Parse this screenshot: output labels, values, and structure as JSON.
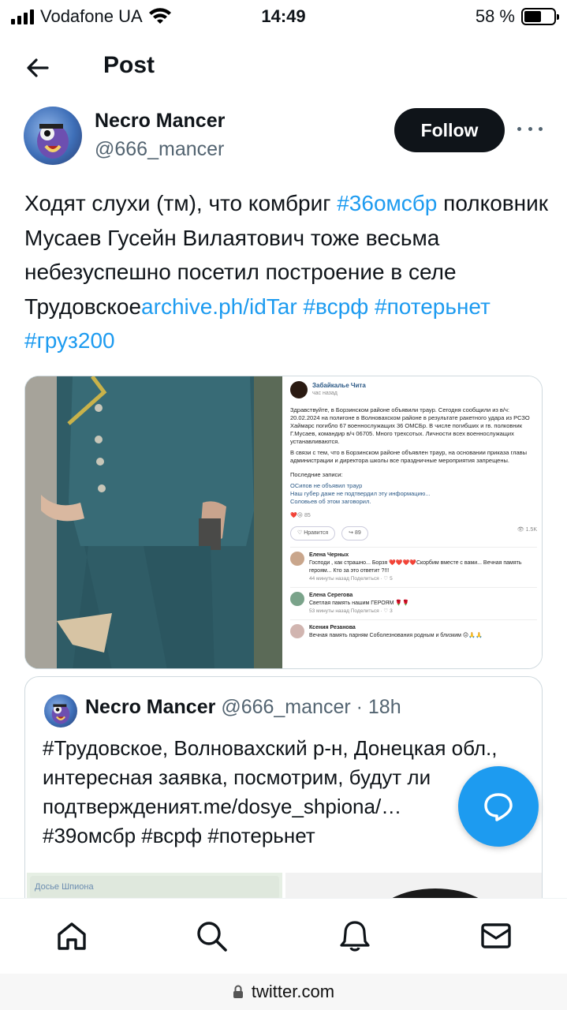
{
  "status_bar": {
    "carrier": "Vodafone UA",
    "time": "14:49",
    "battery_percent": "58 %",
    "battery_level": 0.58
  },
  "header": {
    "title": "Post"
  },
  "author": {
    "name": "Necro Mancer",
    "handle": "@666_mancer",
    "follow_label": "Follow"
  },
  "tweet": {
    "text_plain": "Ходят слухи (тм), что комбриг ",
    "hashtag_1": "#36омсбр",
    "text_plain_2": " полковник Мусаев Гусейн Вилаятович тоже весьма небезуспешно посетил построение в селе Трудовское",
    "link": "archive.ph/idTar",
    "hashtag_2": "#всрф",
    "hashtag_3": "#потерьнет",
    "hashtag_4": "#груз200"
  },
  "media_screenshot": {
    "channel": "Забайкалье Чита",
    "subtitle": "час назад",
    "paragraph_1": "Здравствуйте, в Борзинском районе объявили траур. Сегодня сообщили из в/ч: 20.02.2024 на полигоне в Волновахском районе в результате ракетного удара из РСЗО Хаймарс погибло 67 военнослужащих 36 ОМСБр. В числе погибших и гв. полковник Г.Мусаев, командир в/ч 06705. Много трехсотых. Личности всех военнослужащих устанавливаются.",
    "paragraph_2": "В связи с тем, что в Борзинском районе объявлен траур, на основании приказа главы администрации и директора школы все праздничные мероприятия запрещены.",
    "recent_label": "Последние записи:",
    "recent_links": [
      "ОСипов не объявил траур",
      "Наш губер даже не подтвердил эту информацию...",
      "Соловьев об этом заговорил."
    ],
    "reactions_count": "85",
    "like_label": "Нравится",
    "share_count": "89",
    "views": "1.5K",
    "comments": [
      {
        "name": "Елена Черных",
        "text": "Господи , как страшно... Борзя ❤️❤️❤️❤️Скорбим вместе с вами... Вечная память героям... Кто за это ответит ?!!!",
        "meta": "44 минуты назад   Поделиться",
        "likes": "5"
      },
      {
        "name": "Елена Серегова",
        "text": "Светлая память нашим ГЕРОЯМ 🌹🌹",
        "meta": "53 минуты назад   Поделиться",
        "likes": "3"
      },
      {
        "name": "Ксения Резанова",
        "text": "Вечная память парням Соболезнования родным и близким 😔🙏🙏",
        "meta": "",
        "likes": ""
      }
    ]
  },
  "quote": {
    "name": "Necro Mancer",
    "handle": "@666_mancer",
    "dot": "·",
    "time": "18h",
    "text_line": "#Трудовское, Волновахский р-н, Донецкая обл., интересная заявка, посмотрим, будут ли подтвержденият.me/dosye_shpiona/…",
    "hashtags_line": "#39омсбр #всрф #потерьнет",
    "preview_label": "Досье Шпиона"
  },
  "url_bar": {
    "domain": "twitter.com"
  },
  "colors": {
    "accent": "#1d9bf0",
    "text": "#0f1419",
    "secondary": "#536471",
    "follow_bg": "#0f1419"
  },
  "icons": [
    "back-arrow-icon",
    "more-icon",
    "compose-reply-icon",
    "home-icon",
    "search-icon",
    "bell-icon",
    "mail-icon",
    "lock-icon"
  ]
}
